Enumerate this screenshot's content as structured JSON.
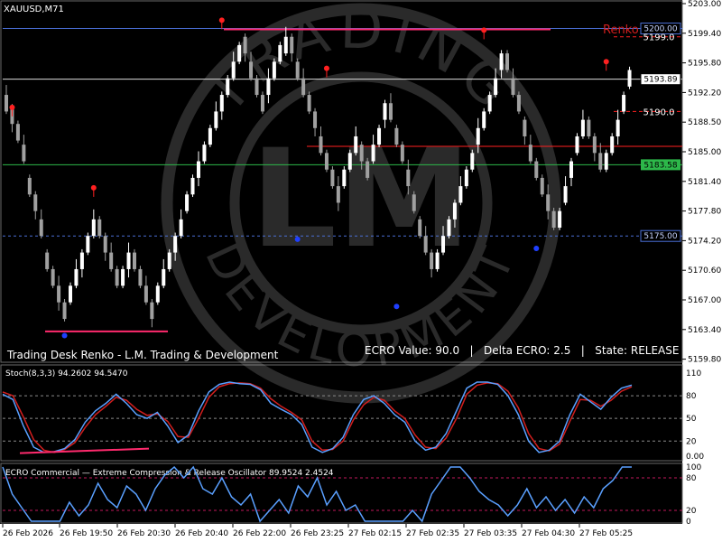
{
  "symbol_label": "XAUUSD,M71",
  "overlay": {
    "footer_title": "Trading Desk Renko - L.M. Trading & Development",
    "ecro_status": "ECRO Value: 90.0   |   Delta ECRO: 2.5   |   State: RELEASE",
    "renko_label": "Renko",
    "watermark_top": "TRADING",
    "watermark_bottom": "DEVELOPMENT",
    "watermark_monogram": "LM"
  },
  "colors": {
    "background": "#000000",
    "bull_candle": "#ffffff",
    "bear_candle": "#a0a0a0",
    "red_marker": "#ff2020",
    "blue_marker": "#1f3fff",
    "pink_trend": "#ff2a6d",
    "blue_level": "#4a6fd6",
    "green_level": "#2db84a",
    "stoch_main": "#5aa0ff",
    "stoch_signal": "#d21e1e",
    "grid_dashed": "#8a8a8a"
  },
  "chart_data": [
    {
      "type": "candlestick",
      "name": "price",
      "ylim": [
        5160.0,
        5203.0
      ],
      "y_ticks": [
        "5203.00",
        "5199.40",
        "5195.80",
        "5192.20",
        "5188.50",
        "5185.00",
        "5181.40",
        "5177.80",
        "5174.20",
        "5170.60",
        "5167.00",
        "5163.40",
        "5159.80"
      ],
      "levels": [
        {
          "value": 5200.0,
          "label": "5200.00",
          "style": "blue"
        },
        {
          "value": 5199.0,
          "label": "5199.0",
          "style": "red"
        },
        {
          "value": 5193.89,
          "label": "5193.89",
          "style": "white"
        },
        {
          "value": 5190.0,
          "label": "5190.0",
          "style": "red"
        },
        {
          "value": 5185.8,
          "label": "",
          "style": "red"
        },
        {
          "value": 5183.58,
          "label": "5183.58",
          "style": "green"
        },
        {
          "value": 5175.0,
          "label": "5175.00",
          "style": "blue-dashed"
        }
      ],
      "renko_bricks_close": [
        5190.0,
        5188.5,
        5186.5,
        5184.0,
        5180.0,
        5178.0,
        5175.0,
        5171.0,
        5169.0,
        5167.0,
        5165.0,
        5169.0,
        5171.0,
        5173.0,
        5175.0,
        5177.0,
        5175.0,
        5173.0,
        5171.0,
        5169.0,
        5171.0,
        5173.0,
        5171.0,
        5169.0,
        5167.0,
        5165.0,
        5169.0,
        5171.0,
        5173.0,
        5175.0,
        5177.0,
        5180.0,
        5182.0,
        5184.0,
        5186.0,
        5188.0,
        5190.0,
        5192.0,
        5194.0,
        5196.0,
        5198.0,
        5197.0,
        5194.0,
        5192.0,
        5190.0,
        5194.0,
        5196.0,
        5198.0,
        5199.0,
        5197.0,
        5194.0,
        5192.0,
        5190.0,
        5188.0,
        5185.0,
        5183.0,
        5181.0,
        5179.0,
        5183.0,
        5185.0,
        5187.0,
        5184.0,
        5182.0,
        5186.0,
        5188.0,
        5191.0,
        5189.0,
        5186.0,
        5184.0,
        5181.0,
        5178.0,
        5175.0,
        5173.0,
        5171.0,
        5173.0,
        5175.0,
        5177.0,
        5179.0,
        5181.0,
        5183.0,
        5185.0,
        5188.0,
        5190.0,
        5192.0,
        5194.0,
        5197.0,
        5195.0,
        5192.0,
        5190.0,
        5187.0,
        5184.0,
        5182.0,
        5180.0,
        5178.0,
        5176.0,
        5178.0,
        5181.0,
        5184.0,
        5187.0,
        5189.0,
        5187.0,
        5185.0,
        5183.0,
        5185.0,
        5187.0,
        5189.0,
        5192.0,
        5195.0
      ],
      "up_fractal_markers": [
        5190.5,
        5180.8,
        5201.0,
        5195.2,
        5199.8,
        5196.0
      ],
      "down_fractal_markers": [
        5163.0,
        5174.6,
        5166.5,
        5173.5
      ],
      "support_line_value": 5163.5,
      "resistance_line_value": 5199.9
    },
    {
      "type": "line",
      "name": "Stoch(8,3,3)",
      "title": "Stoch(8,3,3) 94.2602 94.5470",
      "ylim": [
        0,
        110
      ],
      "y_ticks": [
        "110",
        "80",
        "50",
        "20",
        "0.00"
      ],
      "levels": [
        80,
        50,
        20
      ],
      "series": [
        {
          "name": "Stoch main",
          "values": [
            82,
            75,
            40,
            12,
            5,
            6,
            10,
            22,
            45,
            60,
            70,
            82,
            70,
            55,
            50,
            58,
            40,
            18,
            28,
            60,
            85,
            95,
            98,
            96,
            95,
            88,
            70,
            62,
            55,
            42,
            12,
            5,
            10,
            25,
            55,
            75,
            80,
            70,
            55,
            45,
            20,
            8,
            12,
            30,
            60,
            90,
            98,
            98,
            95,
            80,
            55,
            20,
            5,
            8,
            20,
            55,
            82,
            72,
            62,
            78,
            90,
            94
          ]
        },
        {
          "name": "Stoch signal",
          "values": [
            85,
            80,
            52,
            22,
            8,
            5,
            9,
            18,
            38,
            55,
            66,
            78,
            74,
            62,
            54,
            56,
            46,
            26,
            25,
            50,
            78,
            92,
            96,
            97,
            96,
            90,
            76,
            66,
            58,
            48,
            20,
            8,
            9,
            20,
            48,
            68,
            78,
            74,
            60,
            50,
            28,
            12,
            10,
            24,
            50,
            82,
            94,
            97,
            96,
            86,
            64,
            30,
            10,
            7,
            16,
            46,
            75,
            74,
            66,
            74,
            86,
            92
          ]
        }
      ]
    },
    {
      "type": "line",
      "name": "ECRO",
      "title": "ECRO Commercial — Extreme Compression & Release Oscillator 89.9524 2.4524",
      "ylim": [
        0,
        100
      ],
      "y_ticks": [
        "100",
        "80",
        "20",
        "0"
      ],
      "levels": [
        80,
        20
      ],
      "series": [
        {
          "name": "ECRO",
          "values": [
            100,
            50,
            25,
            0,
            0,
            0,
            0,
            35,
            10,
            30,
            70,
            40,
            25,
            65,
            50,
            20,
            60,
            85,
            100,
            80,
            100,
            60,
            50,
            80,
            45,
            30,
            50,
            0,
            20,
            40,
            15,
            65,
            45,
            80,
            30,
            55,
            20,
            30,
            0,
            0,
            0,
            0,
            0,
            20,
            0,
            50,
            75,
            100,
            100,
            80,
            55,
            40,
            30,
            10,
            30,
            60,
            25,
            45,
            20,
            40,
            15,
            45,
            25,
            60,
            75,
            100,
            100
          ]
        }
      ]
    }
  ],
  "time_axis": [
    "26 Feb 2026",
    "26 Feb 19:50",
    "26 Feb 20:30",
    "26 Feb 20:40",
    "26 Feb 22:00",
    "26 Feb 23:25",
    "27 Feb 02:15",
    "27 Feb 02:35",
    "27 Feb 03:35",
    "27 Feb 04:30",
    "27 Feb 05:25"
  ]
}
